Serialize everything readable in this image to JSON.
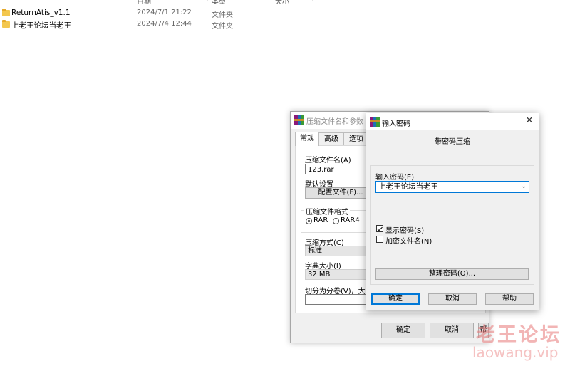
{
  "explorer": {
    "header": {
      "col1": "日期",
      "col2": "类型",
      "col3": "大小"
    },
    "files": [
      {
        "name": "ReturnAtis_v1.1",
        "date": "2024/7/1 21:22",
        "type": "文件夹"
      },
      {
        "name": "上老王论坛当老王",
        "date": "2024/7/4 12:44",
        "type": "文件夹"
      }
    ]
  },
  "rar_dialog": {
    "title": "压缩文件名和参数",
    "tabs": [
      "常规",
      "高级",
      "选项"
    ],
    "archive_name_label": "压缩文件名(A)",
    "archive_name_value": "123.rar",
    "default_settings_label": "默认设置",
    "profiles_button": "配置文件(F)...",
    "format_group_label": "压缩文件格式",
    "format_options": [
      "RAR",
      "RAR4"
    ],
    "format_selected": "RAR",
    "method_label": "压缩方式(C)",
    "method_value": "标准",
    "dict_label": "字典大小(I)",
    "dict_value": "32 MB",
    "split_label": "切分为分卷(V)，大小",
    "split_value": "",
    "ok_button": "确定",
    "cancel_button": "取消",
    "help_button": "帮助"
  },
  "password_dialog": {
    "title": "输入密码",
    "heading": "带密码压缩",
    "enter_label": "输入密码(E)",
    "password_value": "上老王论坛当老王",
    "show_password_label": "显示密码(S)",
    "show_password_checked": true,
    "encrypt_names_label": "加密文件名(N)",
    "encrypt_names_checked": false,
    "organize_button": "整理密码(O)...",
    "ok_button": "确定",
    "cancel_button": "取消",
    "help_button": "帮助"
  },
  "watermark": {
    "text": "老王论坛",
    "url": "laowang.vip"
  }
}
